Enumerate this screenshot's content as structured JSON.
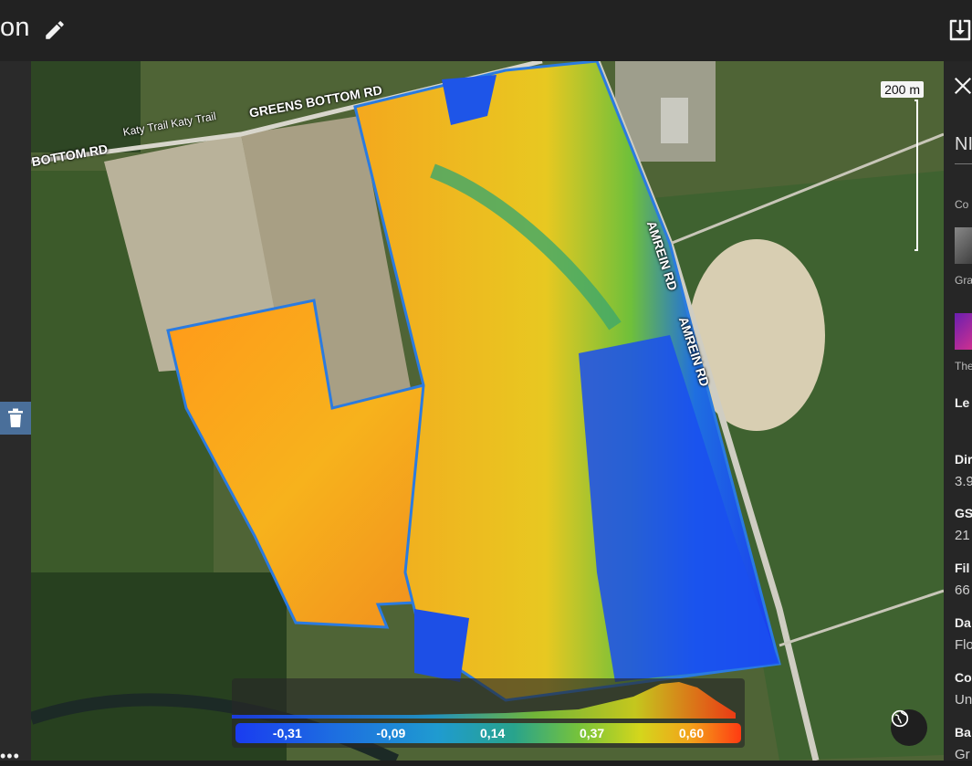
{
  "header": {
    "title": "on",
    "edit_icon": "pencil-icon",
    "download_icon": "download-icon"
  },
  "sidebar": {
    "delete_icon": "trash-icon",
    "more_label": "•••"
  },
  "map": {
    "roads": {
      "greens_bottom": "GREENS BOTTOM RD",
      "bottom_rd": "BOTTOM RD",
      "katy_trail": "Katy Trail Katy Trail",
      "amrein_1": "AMREIN RD",
      "amrein_2": "AMREIN RD"
    },
    "scale_label": "200 m",
    "globe_icon": "globe-icon"
  },
  "legend": {
    "ticks": [
      "-0,31",
      "-0,09",
      "0,14",
      "0,37",
      "0,60"
    ],
    "colors": [
      "#1a3cf0",
      "#1f9bd0",
      "#77c33a",
      "#d4d61c",
      "#ff3b12"
    ]
  },
  "right_panel": {
    "close_icon": "close-icon",
    "title": "NI",
    "subtitle": "Co",
    "swatch1_label": "Gra",
    "swatch2_label": "The",
    "legend_head": "Le",
    "rows": [
      {
        "label": "Dir",
        "value": "3.9"
      },
      {
        "label": "GS",
        "value": "21"
      },
      {
        "label": "Fil",
        "value": "66"
      },
      {
        "label": "Da",
        "value": "Flo"
      },
      {
        "label": "Co",
        "value": "Un"
      },
      {
        "label": "Ba",
        "value": "Gr"
      }
    ]
  }
}
